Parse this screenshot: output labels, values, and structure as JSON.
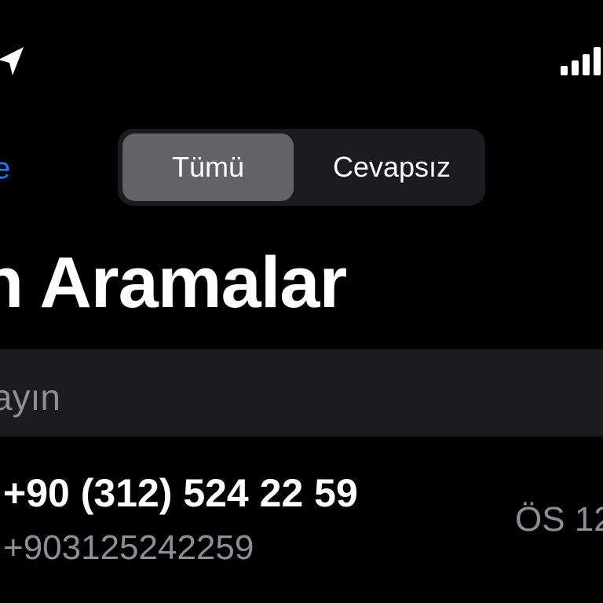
{
  "status_bar": {
    "location_icon": "location-arrow-icon",
    "signal_icon": "cellular-signal-icon"
  },
  "nav": {
    "edit_label": "e",
    "segments": [
      {
        "label": "Tümü",
        "selected": true
      },
      {
        "label": "Cevapsız",
        "selected": false
      }
    ]
  },
  "title": "n Aramalar",
  "search": {
    "placeholder": "ayın"
  },
  "calls": [
    {
      "number": "+90 (312) 524 22 59",
      "subtitle": "+903125242259",
      "time": "ÖS 12"
    }
  ],
  "colors": {
    "background": "#000000",
    "accent": "#0a84ff",
    "secondary_text": "#8e8e93",
    "control_bg": "#1c1c1e",
    "selected_segment": "#636366"
  }
}
